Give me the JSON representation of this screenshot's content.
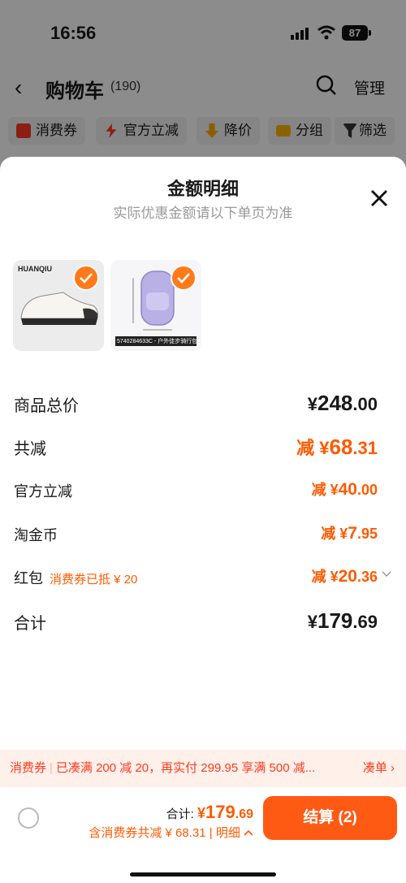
{
  "status": {
    "time": "16:56",
    "battery": "87"
  },
  "header": {
    "title": "购物车",
    "count": "(190)",
    "manage": "管理"
  },
  "filters": [
    {
      "label": "消费券",
      "icon": "coupon-icon",
      "color": "#ff3a1f"
    },
    {
      "label": "官方立减",
      "icon": "lightning-icon",
      "color": "#ff3a1f"
    },
    {
      "label": "降价",
      "icon": "price-down-icon",
      "color": "#ffaa00"
    },
    {
      "label": "分组",
      "icon": "folder-icon",
      "color": "#ffb300"
    },
    {
      "label": "筛选",
      "icon": "filter-icon",
      "color": "#333333"
    }
  ],
  "sheet": {
    "title": "金额明细",
    "subtitle": "实际优惠金额请以下单页为准",
    "products": [
      {
        "name": "sneaker-product",
        "brand_text": "HUANQIU"
      },
      {
        "name": "backpack-product",
        "caption": "5740284633C - 户外徒步骑行包"
      }
    ],
    "rows": {
      "goods_total": {
        "label": "商品总价",
        "value_sym": "¥",
        "value_int": "248",
        "value_dec": ".00"
      },
      "total_discount": {
        "label": "共减",
        "prefix": "减",
        "value_sym": "¥",
        "value_int": "68",
        "value_dec": ".31"
      },
      "official": {
        "label": "官方立减",
        "prefix": "减",
        "value_sym": "¥",
        "value_int": "40",
        "value_dec": ".00"
      },
      "coins": {
        "label": "淘金币",
        "prefix": "减",
        "value_sym": "¥",
        "value_int": "7",
        "value_dec": ".95"
      },
      "redpacket": {
        "label": "红包",
        "note": "消费券已抵 ¥ 20",
        "prefix": "减",
        "value_sym": "¥",
        "value_int": "20",
        "value_dec": ".36"
      },
      "sum": {
        "label": "合计",
        "value_sym": "¥",
        "value_int": "179",
        "value_dec": ".69"
      }
    }
  },
  "promo": {
    "tag": "消费券",
    "text": "已凑满 200 减 20，再实付 299.95 享满 500 减...",
    "action": "凑单 ›"
  },
  "footer": {
    "total_label": "合计: ",
    "total_sym": "¥",
    "total_int": "179",
    "total_dec": ".69",
    "detail_text": "含消费券共减 ¥ 68.31 | 明细",
    "checkout": "结算 (2)"
  },
  "colors": {
    "accent": "#ff5a00",
    "checkout_bg": "#ff5a14"
  }
}
